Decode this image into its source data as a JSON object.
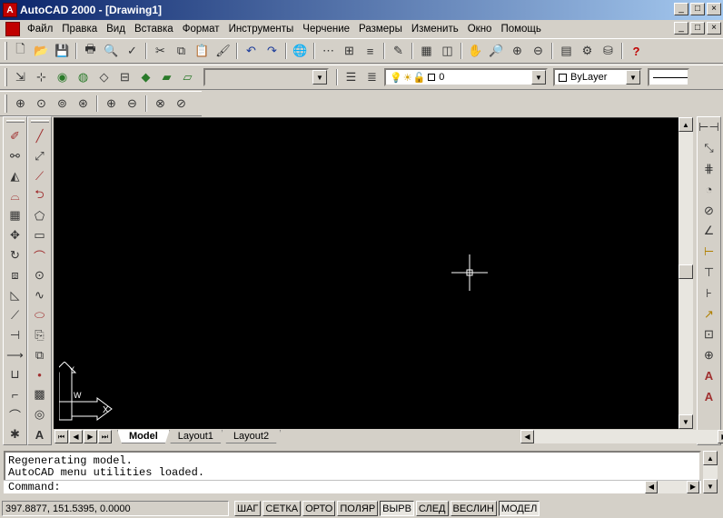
{
  "window": {
    "title": "AutoCAD 2000 - [Drawing1]",
    "app_icon_letter": "A",
    "min_label": "_",
    "max_label": "□",
    "close_label": "×"
  },
  "menu": {
    "items": [
      "Файл",
      "Правка",
      "Вид",
      "Вставка",
      "Формат",
      "Инструменты",
      "Черчение",
      "Размеры",
      "Изменить",
      "Окно",
      "Помощь"
    ],
    "underline_first_letter": true
  },
  "toolbar_standard": {
    "icons": [
      "new-icon",
      "open-icon",
      "save-icon",
      "print-icon",
      "print-preview-icon",
      "spellcheck-icon",
      "cut-icon",
      "copy-icon",
      "paste-icon",
      "match-properties-icon",
      "undo-icon",
      "redo-icon",
      "web-icon",
      "snap-from-icon",
      "insert-icon",
      "tracking-icon",
      "edit-icon",
      "pan-icon",
      "zoom-realtime-icon",
      "properties-icon",
      "design-center-icon",
      "database-icon",
      "help-icon"
    ]
  },
  "layer_toolbar": {
    "layer_value": "0",
    "color_value": "ByLayer",
    "linetype_value": ""
  },
  "cmd": {
    "history": [
      "Regenerating model.",
      "AutoCAD menu utilities loaded."
    ],
    "prompt": "Command:"
  },
  "tabs": {
    "items": [
      "Model",
      "Layout1",
      "Layout2"
    ],
    "active": "Model"
  },
  "ucs": {
    "x_label": "X",
    "y_label": "Y",
    "w_label": "W"
  },
  "status": {
    "coordinates": "397.8877, 151.5395, 0.0000",
    "buttons": [
      "ШАГ",
      "СЕТКА",
      "ОРТО",
      "ПОЛЯР",
      "ВЫРВ",
      "СЛЕД",
      "ВЕСЛИН",
      "МОДЕЛ"
    ],
    "pressed": [
      "ВЫРВ",
      "МОДЕЛ"
    ]
  },
  "colors": {
    "titlebar_start": "#0a246a",
    "titlebar_end": "#a6caf0",
    "canvas": "#000000",
    "face": "#d4d0c8"
  }
}
